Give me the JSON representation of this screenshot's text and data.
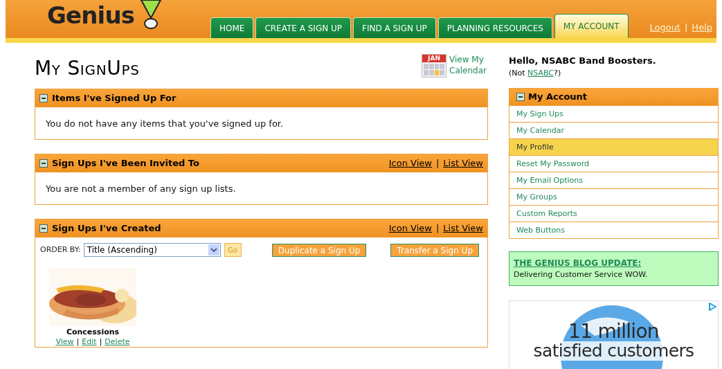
{
  "header": {
    "logo": "Genius",
    "nav": [
      {
        "label": "HOME",
        "selected": false
      },
      {
        "label": "CREATE A SIGN UP",
        "selected": false
      },
      {
        "label": "FIND A SIGN UP",
        "selected": false
      },
      {
        "label": "PLANNING RESOURCES",
        "selected": false
      },
      {
        "label": "MY ACCOUNT",
        "selected": true
      }
    ],
    "links": [
      "Logout",
      "Help"
    ],
    "separator": "|"
  },
  "page": {
    "title": "My SignUps",
    "calendar_link": "View My Calendar",
    "calendar_icon_text": "JAN"
  },
  "sections": [
    {
      "title": "Items I've Signed Up For",
      "message": "You do not have any items that you've signed up for."
    },
    {
      "title": "Sign Ups I've Been Invited To",
      "view_links": [
        "Icon View",
        "List View"
      ],
      "separator": "|",
      "message": "You are not a member of any sign up lists."
    },
    {
      "title": "Sign Ups I've Created",
      "view_links": [
        "Icon View",
        "List View"
      ],
      "separator": "|",
      "order_label": "ORDER BY:",
      "order_value": "Title (Ascending)",
      "go": "Go",
      "buttons": [
        "Duplicate a Sign Up",
        "Transfer a Sign Up"
      ],
      "signups": [
        {
          "name": "Concessions",
          "actions": [
            "View",
            "Edit",
            "Delete"
          ],
          "separator": "|"
        }
      ]
    }
  ],
  "sidebar": {
    "greeting": "Hello, NSABC Band Boosters.",
    "not_prefix": "(Not ",
    "not_link": "NSABC",
    "not_suffix": "?)",
    "menu_title": "My Account",
    "items": [
      {
        "label": "My Sign Ups",
        "selected": false
      },
      {
        "label": "My Calendar",
        "selected": false
      },
      {
        "label": "My Profile",
        "selected": true
      },
      {
        "label": "Reset My Password",
        "selected": false
      },
      {
        "label": "My Email Options",
        "selected": false
      },
      {
        "label": "My Groups",
        "selected": false
      },
      {
        "label": "Custom Reports",
        "selected": false
      },
      {
        "label": "Web Buttons",
        "selected": false
      }
    ],
    "blog_title": "THE GENIUS BLOG UPDATE:",
    "blog_text": "Delivering Customer Service WOW.",
    "ad_line1": "11 million",
    "ad_line2": "satisfied customers"
  }
}
